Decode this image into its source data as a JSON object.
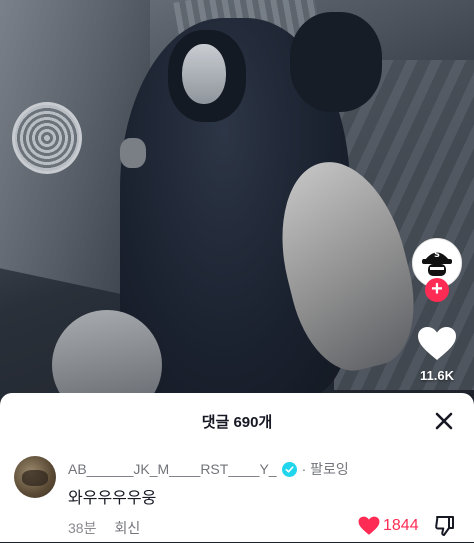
{
  "video": {
    "like_count": "11.6K"
  },
  "comments_sheet": {
    "title": "댓글 690개",
    "comment": {
      "username": "AB______JK_M____RST____Y_",
      "follow_label": "· 팔로잉",
      "text": "와우우우우웅",
      "time_ago": "38분",
      "reply_label": "회신",
      "like_count": "1844"
    }
  },
  "colors": {
    "accent": "#fe2c55",
    "verified": "#20d5ec"
  },
  "icons": {
    "close": "close-icon",
    "heart": "heart-icon",
    "dislike": "thumbs-down-icon",
    "follow": "plus-icon"
  }
}
